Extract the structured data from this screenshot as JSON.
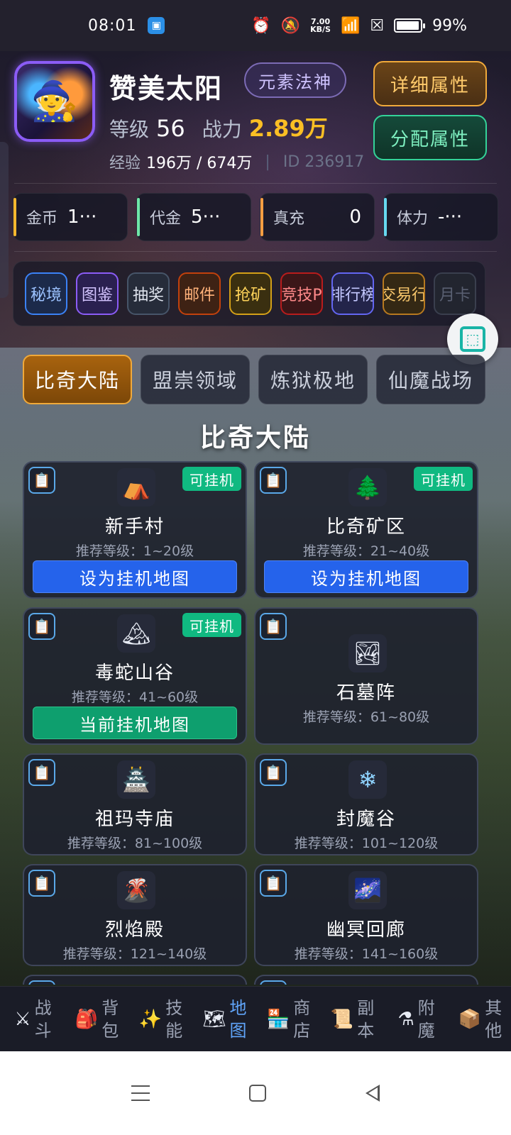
{
  "status_bar": {
    "time": "08:01",
    "net_speed": "7.00",
    "net_unit": "KB/S",
    "battery": "99%"
  },
  "profile": {
    "name": "赞美太阳",
    "class": "元素法神",
    "level_label": "等级",
    "level": "56",
    "power_label": "战力",
    "power": "2.89万",
    "exp_label": "经验",
    "exp": "196万 / 674万",
    "id_text": "ID 236917",
    "detail_button": "详细属性",
    "allocate_button": "分配属性"
  },
  "currencies": [
    {
      "label": "金币",
      "value": "1···",
      "color": "#f5b82e"
    },
    {
      "label": "代金",
      "value": "5···",
      "color": "#6ee7a8"
    },
    {
      "label": "真充",
      "value": "0",
      "color": "#f59e42"
    },
    {
      "label": "体力",
      "value": "-···",
      "color": "#67d8f0"
    }
  ],
  "quick_buttons": [
    {
      "label": "秘境",
      "border": "#3b82f6",
      "bg": "#1c2a4a",
      "text": "#9cc2ff"
    },
    {
      "label": "图鉴",
      "border": "#8b5cf6",
      "bg": "#2a2050",
      "text": "#d3c4ff"
    },
    {
      "label": "抽奖",
      "border": "#475569",
      "bg": "#262c3a",
      "text": "#dfe4ee"
    },
    {
      "label": "邮件",
      "border": "#c2410c",
      "bg": "#3e2214",
      "text": "#ffb27a"
    },
    {
      "label": "抢矿",
      "border": "#d4a017",
      "bg": "#3a2f10",
      "text": "#ffd45a"
    },
    {
      "label": "竞技P",
      "border": "#b91c1c",
      "bg": "#3b1618",
      "text": "#ff8a8a"
    },
    {
      "label": "排行榜",
      "border": "#6366f1",
      "bg": "#23244a",
      "text": "#c4c8ff"
    },
    {
      "label": "交易行",
      "border": "#b7791f",
      "bg": "#342814",
      "text": "#f6c56b"
    },
    {
      "label": "月卡",
      "border": "#3a3f4e",
      "bg": "#22252f",
      "text": "#5a6072"
    }
  ],
  "tabs": [
    "比奇大陆",
    "盟崇领域",
    "炼狱极地",
    "仙魔战场"
  ],
  "region_title": "比奇大陆",
  "maps": [
    {
      "name": "新手村",
      "level": "推荐等级：1~20级",
      "icon": "⛺",
      "tag": "可挂机",
      "action": "设为挂机地图"
    },
    {
      "name": "比奇矿区",
      "level": "推荐等级：21~40级",
      "icon": "🌲",
      "tag": "可挂机",
      "action": "设为挂机地图"
    },
    {
      "name": "毒蛇山谷",
      "level": "推荐等级：41~60级",
      "icon": "🏔",
      "tag": "可挂机",
      "action": "当前挂机地图"
    },
    {
      "name": "石墓阵",
      "level": "推荐等级：61~80级",
      "icon": "🏞"
    },
    {
      "name": "祖玛寺庙",
      "level": "推荐等级：81~100级",
      "icon": "🏯"
    },
    {
      "name": "封魔谷",
      "level": "推荐等级：101~120级",
      "icon": "❄"
    },
    {
      "name": "烈焰殿",
      "level": "推荐等级：121~140级",
      "icon": "🌋"
    },
    {
      "name": "幽冥回廊",
      "level": "推荐等级：141~160级",
      "icon": "🌌"
    }
  ],
  "clipboard_icon": "📋",
  "bottom_nav": [
    {
      "icon": "⚔",
      "label": "战斗"
    },
    {
      "icon": "🎒",
      "label": "背包"
    },
    {
      "icon": "✨",
      "label": "技能"
    },
    {
      "icon": "🗺",
      "label": "地图",
      "active": true
    },
    {
      "icon": "🏪",
      "label": "商店"
    },
    {
      "icon": "📜",
      "label": "副本"
    },
    {
      "icon": "⚗",
      "label": "附魔"
    },
    {
      "icon": "📦",
      "label": "其他"
    }
  ]
}
